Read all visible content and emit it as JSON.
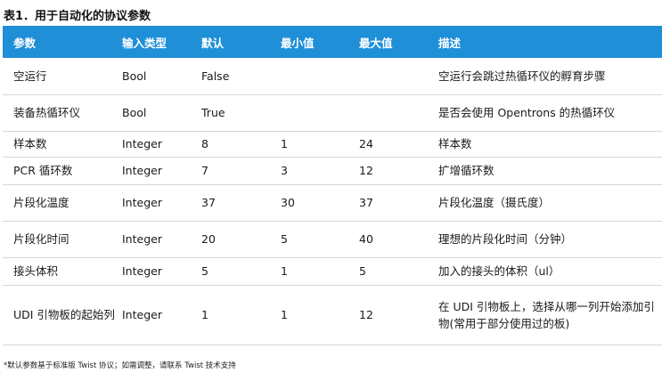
{
  "title": "表1．用于自动化的协议参数",
  "columns": [
    "参数",
    "输入类型",
    "默认",
    "最小值",
    "最大值",
    "描述"
  ],
  "rows": [
    [
      "空运行",
      "Bool",
      "False",
      "",
      "",
      "空运行会跳过热循环仪的孵育步骤"
    ],
    [
      "装备热循环仪",
      "Bool",
      "True",
      "",
      "",
      "是否会使用 Opentrons 的热循环仪"
    ],
    [
      "样本数",
      "Integer",
      "8",
      "1",
      "24",
      "样本数"
    ],
    [
      "PCR 循环数",
      "Integer",
      "7",
      "3",
      "12",
      "扩增循环数"
    ],
    [
      "片段化温度",
      "Integer",
      "37",
      "30",
      "37",
      "片段化温度（摄氏度）"
    ],
    [
      "片段化时间",
      "Integer",
      "20",
      "5",
      "40",
      "理想的片段化时间（分钟）"
    ],
    [
      "接头体积",
      "Integer",
      "5",
      "1",
      "5",
      "加入的接头的体积（ul）"
    ],
    [
      "UDI 引物板的起始列",
      "Integer",
      "1",
      "1",
      "12",
      "在 UDI 引物板上，选择从哪一列开始添加引物(常用于部分使用过的板)"
    ]
  ],
  "footnote": "*默认参数基于标准版 Twist 协议；如需调整，请联系 Twist 技术支持"
}
